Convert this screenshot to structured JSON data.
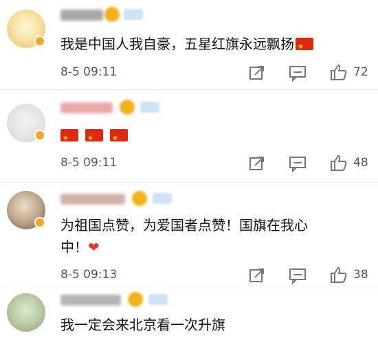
{
  "comments": [
    {
      "text": "我是中国人我自豪，五星红旗永远飘扬",
      "time": "8-5 09:11",
      "likes": "72"
    },
    {
      "text": "",
      "time": "8-5 09:11",
      "likes": "48"
    },
    {
      "text_line1": "为祖国点赞，为爱国者点赞！国旗在我心",
      "text_line2": "中！",
      "time": "8-5 09:13",
      "likes": "38"
    },
    {
      "text": "我一定会来北京看一次升旗"
    }
  ],
  "colors": {
    "flag_red": "#de2910",
    "heart_red": "#e53935",
    "meta_gray": "#555555"
  },
  "icons": [
    "share-icon",
    "comment-icon",
    "thumbs-up-icon",
    "china-flag-icon",
    "red-heart-icon"
  ]
}
